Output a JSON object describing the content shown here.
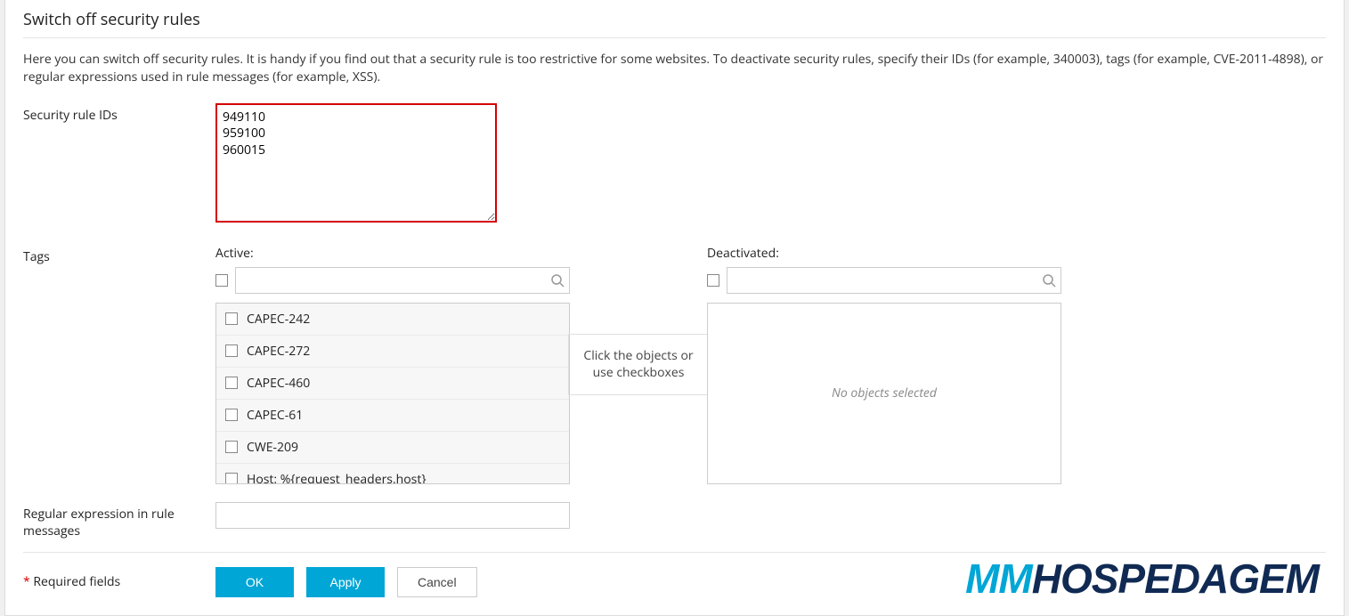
{
  "section_title": "Switch off security rules",
  "description": "Here you can switch off security rules. It is handy if you find out that a security rule is too restrictive for some websites. To deactivate security rules, specify their IDs (for example, 340003), tags (for example, CVE-2011-4898), or regular expressions used in rule messages (for example, XSS).",
  "labels": {
    "rule_ids": "Security rule IDs",
    "tags": "Tags",
    "regex": "Regular expression in rule messages",
    "required": "Required fields"
  },
  "rule_ids_value": "949110\n959100\n960015",
  "tags_picker": {
    "active_label": "Active:",
    "deactivated_label": "Deactivated:",
    "hint": "Click the objects or use checkboxes",
    "empty_text": "No objects selected",
    "active_items": [
      "CAPEC-242",
      "CAPEC-272",
      "CAPEC-460",
      "CAPEC-61",
      "CWE-209",
      "Host: %{request_headers.host}"
    ]
  },
  "regex_value": "",
  "buttons": {
    "ok": "OK",
    "apply": "Apply",
    "cancel": "Cancel"
  },
  "brand": {
    "mm": "MM",
    "rest": "HOSPEDAGEM"
  }
}
